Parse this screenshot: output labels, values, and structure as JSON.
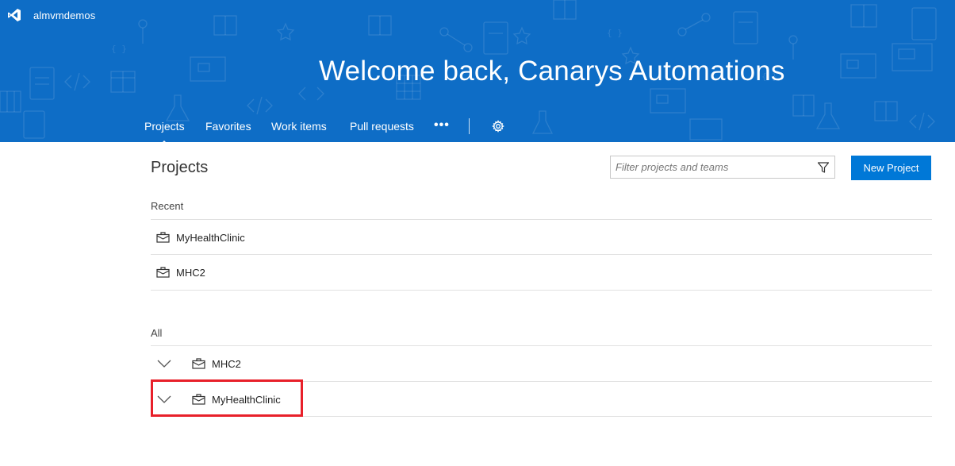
{
  "header": {
    "org_name": "almvmdemos",
    "welcome": "Welcome back, Canarys Automations",
    "nav": [
      {
        "label": "Projects",
        "active": true
      },
      {
        "label": "Favorites",
        "active": false
      },
      {
        "label": "Work items",
        "active": false
      },
      {
        "label": "Pull requests",
        "active": false
      }
    ],
    "more_label": "•••",
    "banner_color": "#0e6dc6"
  },
  "main": {
    "title": "Projects",
    "filter_placeholder": "Filter projects and teams",
    "new_project_label": "New Project",
    "accent_color": "#0078d7",
    "recent_label": "Recent",
    "recent": [
      {
        "name": "MyHealthClinic"
      },
      {
        "name": "MHC2"
      }
    ],
    "all_label": "All",
    "all": [
      {
        "name": "MHC2",
        "expanded": false
      },
      {
        "name": "MyHealthClinic",
        "expanded": false,
        "highlighted": true
      }
    ],
    "highlight_color": "#e8202a"
  }
}
